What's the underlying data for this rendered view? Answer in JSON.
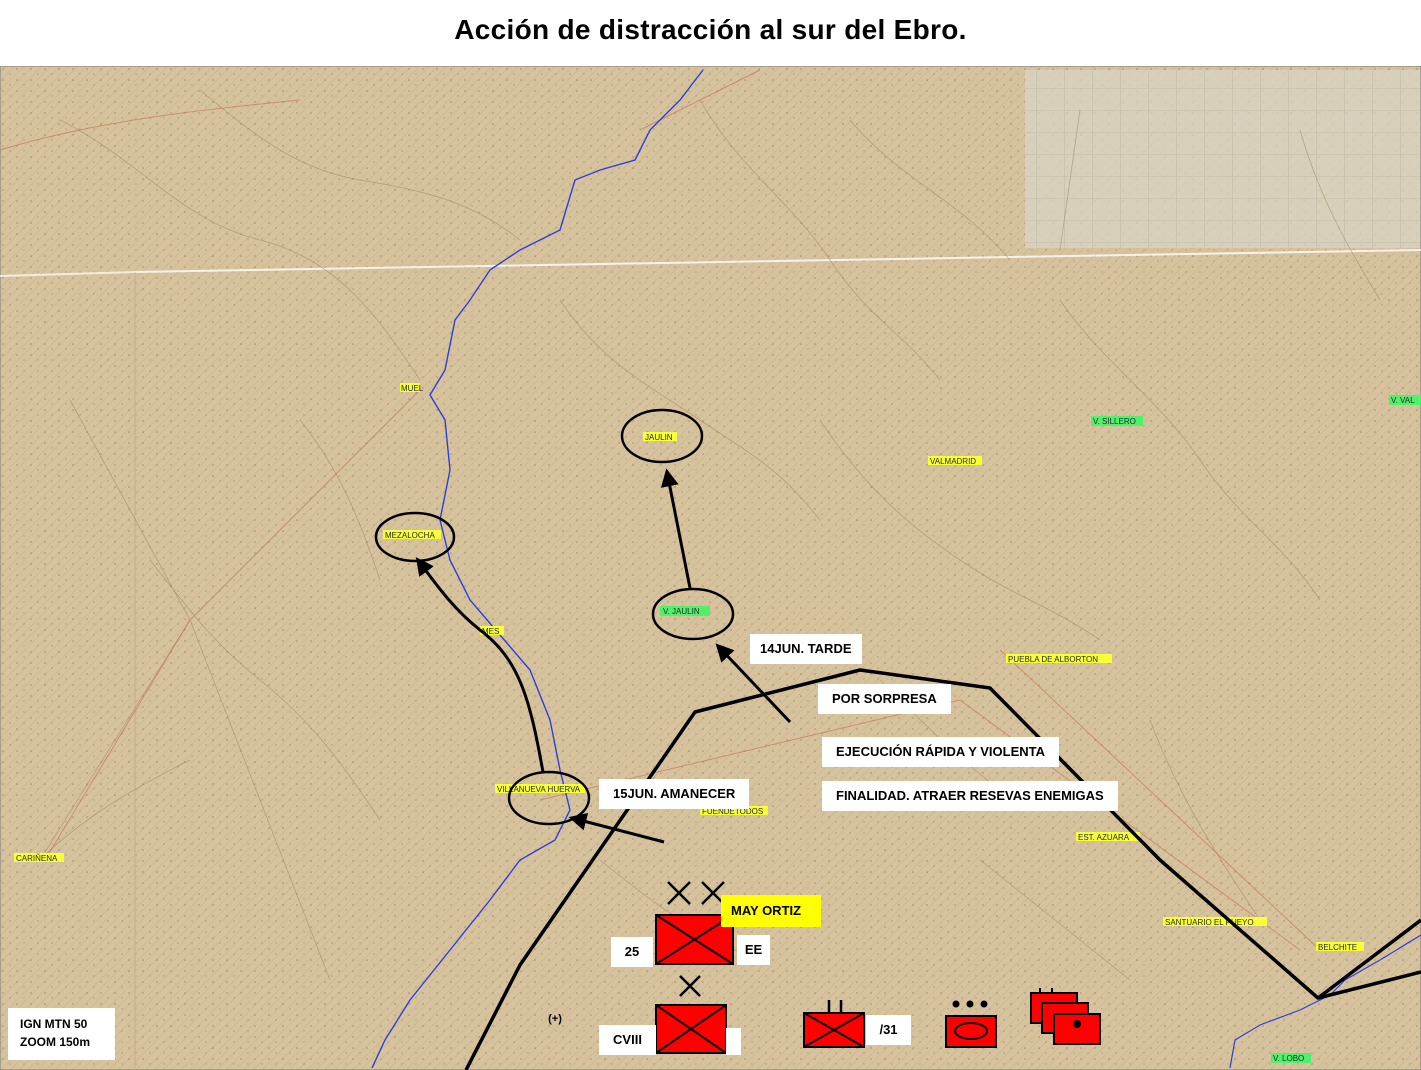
{
  "title": "Acción de distracción al sur del Ebro.",
  "map": {
    "source_line1": "IGN MTN 50",
    "source_line2": "ZOOM 150m",
    "places": {
      "muel": "MUEL",
      "jaulin": "JAULIN",
      "valmadrid": "VALMADRID",
      "v_sillero": "V. SILLERO",
      "v_val": "V. VAL",
      "mezalocha": "MEZALOCHA",
      "v_jaulin": "V. JAULIN",
      "mes": "MES",
      "puebla": "PUEBLA DE ALBORTON",
      "villanueva": "VILLANUEVA HUERVA",
      "fuendetodos": "FUENDETODOS",
      "est_azuara": "EST. AZUARA",
      "carinena": "CARIÑENA",
      "santuario": "SANTUARIO EL PUEYO",
      "belchite": "BELCHITE",
      "v_lobo": "V. LOBO"
    },
    "annotations": {
      "t14": "14JUN. TARDE",
      "sorpresa": "POR SORPRESA",
      "ejecucion": "EJECUCIÓN RÁPIDA Y VIOLENTA",
      "finalidad": "FINALIDAD. ATRAER RESEVAS ENEMIGAS",
      "t15": "15JUN. AMANECER",
      "may_ortiz": "MAY ORTIZ"
    },
    "units": {
      "div_number": "25",
      "div_suffix": "EE",
      "corps": "CVIII",
      "reinforced": "(+)",
      "unit_31": "/31"
    },
    "colors": {
      "unit_fill": "#ff0000",
      "river": "#2f3fd6",
      "front": "#000000",
      "highlight": "#ffff00"
    }
  }
}
